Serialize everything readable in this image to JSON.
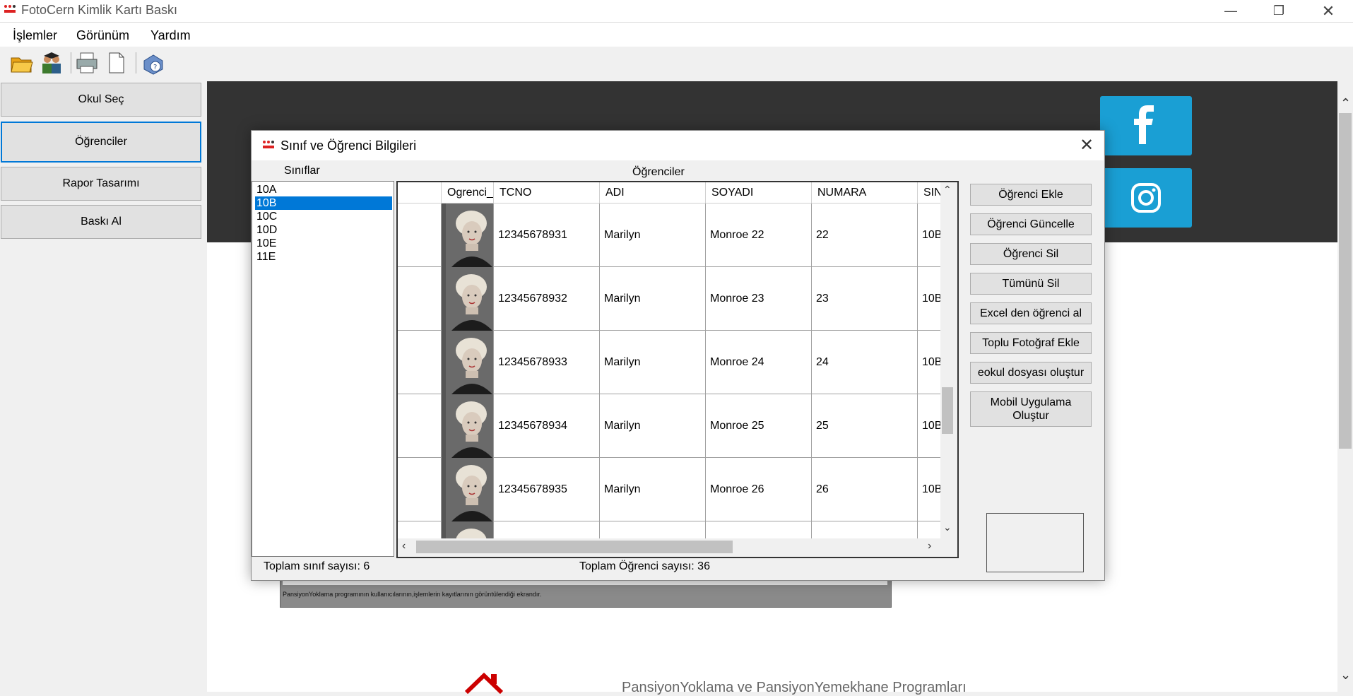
{
  "window": {
    "title": "FotoCern Kimlik Kartı Baskı"
  },
  "menu": [
    "İşlemler",
    "Görünüm",
    "Yardım"
  ],
  "toolbar": {
    "icons": [
      "open-folder-icon",
      "students-icon",
      "printer-icon",
      "new-document-icon",
      "help-icon"
    ]
  },
  "nav": {
    "items": [
      "Okul Seç",
      "Öğrenciler",
      "Rapor Tasarımı",
      "Baskı Al"
    ],
    "active": "Öğrenciler"
  },
  "web": {
    "image_caption": "PansiyonYoklama programının kullanıcılarının,işlemlerin kayıtlarının görüntülendiği ekrandır.",
    "footer_text": "PansiyonYoklama ve PansiyonYemekhane Programları",
    "social_color": "#1a9fd4"
  },
  "dialog": {
    "title": "Sınıf ve Öğrenci Bilgileri",
    "classes_label": "Sınıflar",
    "students_label": "Öğrenciler",
    "classes": [
      "10A",
      "10B",
      "10C",
      "10D",
      "10E",
      "11E"
    ],
    "selected_class": "10B",
    "columns": [
      "",
      "Ogrenci_",
      "TCNO",
      "ADI",
      "SOYADI",
      "NUMARA",
      "SIN"
    ],
    "rows": [
      {
        "tcno": "12345678931",
        "adi": "Marilyn",
        "soyadi": "Monroe 22",
        "numara": "22",
        "sinif": "10B"
      },
      {
        "tcno": "12345678932",
        "adi": "Marilyn",
        "soyadi": "Monroe 23",
        "numara": "23",
        "sinif": "10B"
      },
      {
        "tcno": "12345678933",
        "adi": "Marilyn",
        "soyadi": "Monroe 24",
        "numara": "24",
        "sinif": "10B"
      },
      {
        "tcno": "12345678934",
        "adi": "Marilyn",
        "soyadi": "Monroe 25",
        "numara": "25",
        "sinif": "10B"
      },
      {
        "tcno": "12345678935",
        "adi": "Marilyn",
        "soyadi": "Monroe 26",
        "numara": "26",
        "sinif": "10B"
      }
    ],
    "buttons": [
      "Öğrenci Ekle",
      "Öğrenci Güncelle",
      "Öğrenci Sil",
      "Tümünü Sil",
      "Excel den öğrenci al",
      "Toplu Fotoğraf Ekle",
      "eokul dosyası oluştur",
      "Mobil Uygulama Oluştur"
    ],
    "status_class_count": "Toplam sınıf sayısı: 6",
    "status_student_count": "Toplam Öğrenci sayısı: 36"
  }
}
